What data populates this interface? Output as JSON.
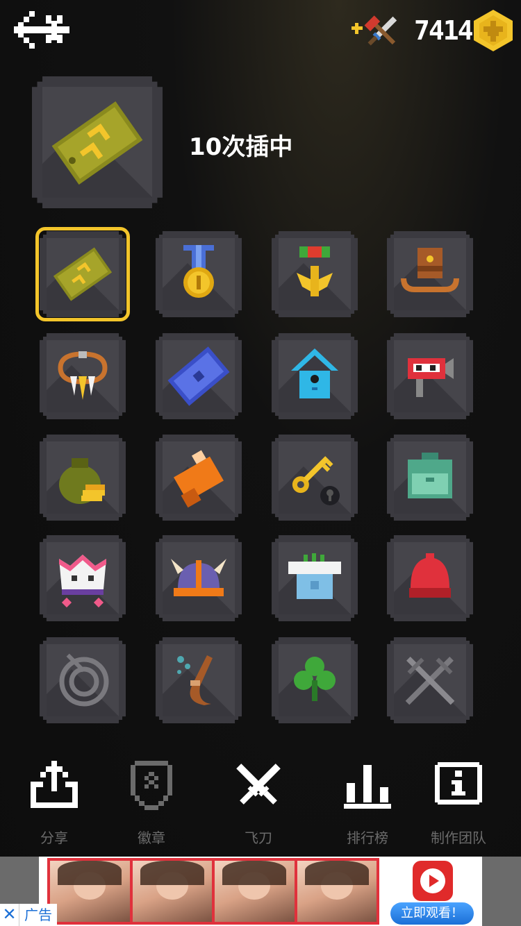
{
  "header": {
    "coins": "7414",
    "back_icon": "back-arrow-icon",
    "weapon_icon": "knife-axe-icon",
    "coin_icon": "eagle-coin-icon"
  },
  "selected_badge": {
    "description": "10次插中",
    "icon": "army-dogtag-icon"
  },
  "badges": [
    {
      "icon": "army-dogtag-icon",
      "selected": true
    },
    {
      "icon": "medal-icon"
    },
    {
      "icon": "eagle-medal-icon"
    },
    {
      "icon": "cowboy-hat-icon"
    },
    {
      "icon": "fang-necklace-icon"
    },
    {
      "icon": "treasure-map-icon"
    },
    {
      "icon": "birdhouse-icon"
    },
    {
      "icon": "robot-head-icon"
    },
    {
      "icon": "money-bag-icon"
    },
    {
      "icon": "fur-hat-icon"
    },
    {
      "icon": "key-lock-icon"
    },
    {
      "icon": "backpack-icon"
    },
    {
      "icon": "crown-icon"
    },
    {
      "icon": "viking-helmet-icon"
    },
    {
      "icon": "cake-house-icon"
    },
    {
      "icon": "red-beanie-icon"
    },
    {
      "icon": "target-icon"
    },
    {
      "icon": "pipe-icon"
    },
    {
      "icon": "clover-icon"
    },
    {
      "icon": "crossed-swords-icon"
    }
  ],
  "nav": {
    "share": "分享",
    "badges": "徽章",
    "knives": "飞刀",
    "leaderboard": "排行榜",
    "credits": "制作团队"
  },
  "ad": {
    "cta": "立即观看！",
    "tag": "广告",
    "close": "✕"
  },
  "colors": {
    "gold": "#f3c52b",
    "tile": "#3b3a40",
    "nav_label": "#6b6b6b"
  }
}
